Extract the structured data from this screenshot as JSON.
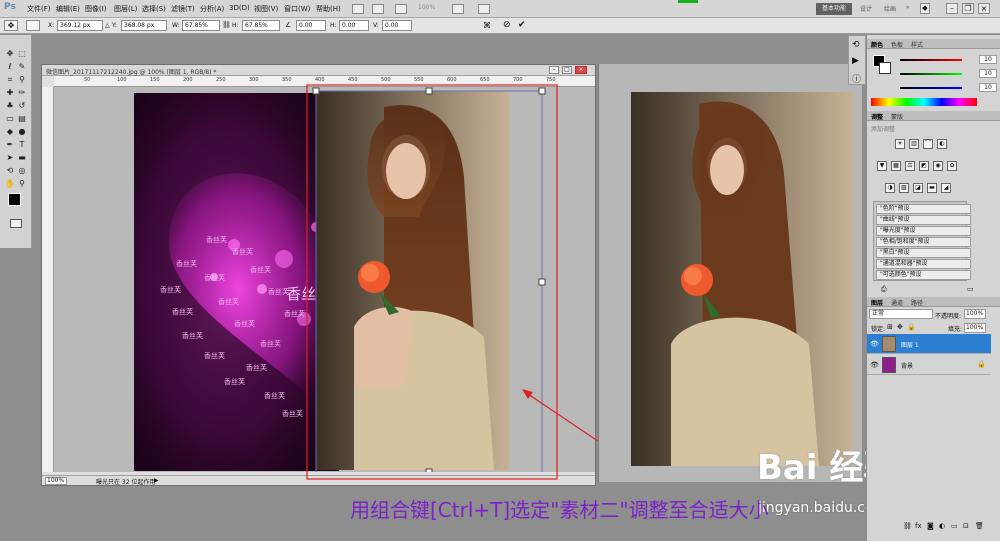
{
  "app": {
    "logo": "Ps"
  },
  "menu": [
    "文件(F)",
    "编辑(E)",
    "图像(I)",
    "图层(L)",
    "选择(S)",
    "滤镜(T)",
    "分析(A)",
    "3D(D)",
    "视图(V)",
    "窗口(W)",
    "帮助(H)"
  ],
  "menu_zoom": "100%",
  "workspace": {
    "active": "基本功能",
    "others": [
      "设计",
      "绘画"
    ]
  },
  "options": {
    "x_label": "X:",
    "x_value": "369.12 px",
    "y_label": "Y:",
    "y_value": "368.08 px",
    "w_label": "W:",
    "w_value": "67.85%",
    "h_label": "H:",
    "h_value": "67.85%",
    "angle_value": "0.00",
    "hskew_label": "H:",
    "hskew_value": "0.00",
    "vskew_label": "V:",
    "vskew_value": "0.00"
  },
  "document1": {
    "title": "微信图片_20171117212240.jpg @ 100% (图层 1, RGB/8) *",
    "ruler_ticks": [
      "50",
      "100",
      "150",
      "200",
      "250",
      "300",
      "350",
      "400",
      "450",
      "500",
      "550",
      "600",
      "650",
      "700",
      "750"
    ],
    "zoom": "100%",
    "status": "曝光只在 32 位起作用"
  },
  "heart_texts": [
    "香丝芙",
    "香丝芙",
    "香丝芙",
    "香丝芙",
    "香丝芙",
    "香丝芙",
    "香丝芙",
    "香丝芙",
    "香丝芙",
    "香丝芙",
    "香丝芙",
    "香丝芙",
    "香丝芙",
    "香丝芙",
    "香丝芙",
    "香丝芙",
    "香丝芙",
    "香丝芙",
    "香丝"
  ],
  "color_panel": {
    "tabs": [
      "颜色",
      "色板",
      "样式"
    ],
    "slider_values": [
      "10",
      "10",
      "10"
    ]
  },
  "adjust_panel": {
    "tabs": [
      "调整",
      "蒙版"
    ],
    "heading": "添加调整",
    "presets": [
      "\"色阶\"预设",
      "\"曲线\"预设",
      "\"曝光度\"预设",
      "\"色相/饱和度\"预设",
      "\"黑白\"预设",
      "\"通道混和器\"预设",
      "\"可选颜色\"预设"
    ]
  },
  "layers_panel": {
    "tabs": [
      "图层",
      "通道",
      "路径"
    ],
    "blend_mode": "正常",
    "opacity_label": "不透明度:",
    "opacity_value": "100%",
    "lock_label": "锁定:",
    "fill_label": "填充:",
    "fill_value": "100%",
    "layers": [
      {
        "name": "图层 1",
        "selected": true
      },
      {
        "name": "背景",
        "selected": false
      }
    ]
  },
  "caption": "用组合键[Ctrl+T]选定\"素材二\"调整至合适大小",
  "watermark": {
    "brand": "Bai 经验",
    "url": "jingyan.baidu.com"
  },
  "colors": {
    "accent": "#2d7fd1",
    "caption": "#7b22c9",
    "arrow": "#e02020",
    "heart": "#d12ec4"
  }
}
